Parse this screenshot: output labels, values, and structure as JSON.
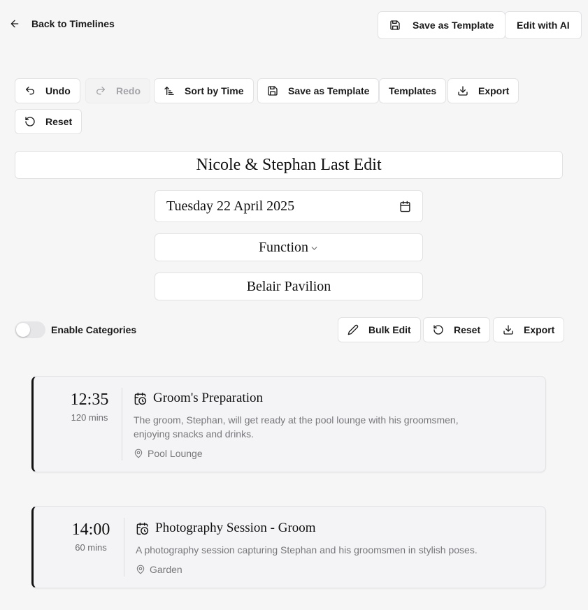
{
  "header": {
    "back_label": "Back to Timelines",
    "save_template_label": "Save as Template",
    "edit_ai_label": "Edit with AI"
  },
  "toolbar": {
    "undo_label": "Undo",
    "redo_label": "Redo",
    "sort_label": "Sort by Time",
    "save_template_label": "Save as Template",
    "templates_label": "Templates",
    "export_label": "Export",
    "reset_label": "Reset"
  },
  "timeline": {
    "title": "Nicole & Stephan Last Edit",
    "date": "Tuesday 22 April 2025",
    "event_type": "Function",
    "venue": "Belair Pavilion"
  },
  "categories": {
    "toggle_label": "Enable Categories",
    "enabled": false
  },
  "actions": {
    "bulk_edit_label": "Bulk Edit",
    "reset_label": "Reset",
    "export_label": "Export"
  },
  "events": [
    {
      "time": "12:35",
      "duration": "120 mins",
      "title": "Groom's Preparation",
      "description": "The groom, Stephan, will get ready at the pool lounge with his groomsmen, enjoying snacks and drinks.",
      "location": "Pool Lounge"
    },
    {
      "time": "14:00",
      "duration": "60 mins",
      "title": "Photography Session - Groom",
      "description": "A photography session capturing Stephan and his groomsmen in stylish poses.",
      "location": "Garden"
    }
  ]
}
